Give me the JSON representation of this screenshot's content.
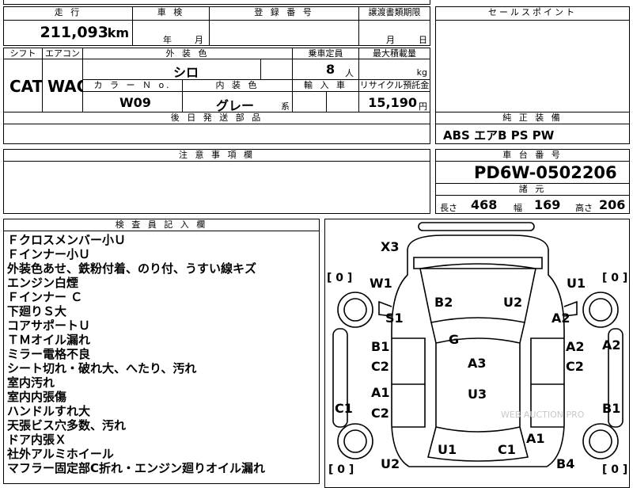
{
  "top_labels": {
    "mileage": "走 行",
    "inspection": "車 検",
    "registration": "登 録 番 号",
    "transfer_deadline": "譲渡書類期限",
    "sales_point": "セールスポイント"
  },
  "values": {
    "mileage": "211,093",
    "mileage_unit": "km",
    "inspection_year": "年",
    "inspection_month": "月",
    "deadline_month": "月",
    "deadline_day": "日"
  },
  "row2": {
    "shift_label": "シフト",
    "aircon_label": "エアコン",
    "exterior_color_label": "外 装 色",
    "capacity_label": "乗車定員",
    "max_load_label": "最大積載量",
    "shift": "CAT",
    "aircon": "WAC",
    "exterior_color": "シロ",
    "capacity": "8",
    "capacity_unit": "人",
    "max_load_unit": "kg",
    "color_no_label": "カ ラ ー Ｎ o.",
    "interior_color_label": "内 装 色",
    "import_label": "輸 入 車",
    "recycle_label": "リサイクル預託金",
    "color_no": "W09",
    "interior_color": "グレー",
    "interior_suffix": "系",
    "recycle_fee": "15,190",
    "recycle_unit": "円"
  },
  "later_parts_label": "後 日 発 送 部 品",
  "standard_equipment_label": "純 正 装 備",
  "standard_equipment": "ABS エアB PS PW",
  "notes_label": "注 意 事 項 欄",
  "chassis_label": "車 台 番 号",
  "chassis_no": "PD6W-0502206",
  "specs_label": "諸 元",
  "specs": {
    "length_label": "長さ",
    "length": "468",
    "width_label": "幅",
    "width": "169",
    "height_label": "高さ",
    "height": "206"
  },
  "inspector_label": "検 査 員 記 入 欄",
  "inspector_notes": [
    "Ｆクロスメンバー小Ｕ",
    "Ｆインナー小Ｕ",
    "外装色あせ、鉄粉付着、のり付、うすい線キズ",
    "エンジン白煙",
    "Ｆインナー Ｃ",
    "下廻りＳ大",
    "コアサポートＵ",
    "ＴＭオイル漏れ",
    "ミラー電格不良",
    "シート切れ・破れ大、へたり、汚れ",
    "室内汚れ",
    "室内内張傷",
    "ハンドルすれ大",
    "天張ビス穴多数、汚れ",
    "ドア内張Ｘ",
    "社外アルミホイール",
    "マフラー固定部C折れ・エンジン廻りオイル漏れ"
  ],
  "diagram": {
    "tire_fl": "[ 0 ]",
    "tire_fr": "[ 0 ]",
    "tire_rl": "[ 0 ]",
    "tire_rr": "[ 0 ]",
    "marks": {
      "x3": "X3",
      "w1": "W1",
      "u1_front": "U1",
      "b2": "B2",
      "u2_hood": "U2",
      "s1": "S1",
      "a2_fender": "A2",
      "b1_door": "B1",
      "g": "G",
      "a2_door": "A2",
      "a2_out": "A2",
      "c2_left1": "C2",
      "a3": "A3",
      "c2_right": "C2",
      "a1_left": "A1",
      "u3": "U3",
      "c1_left": "C1",
      "c2_left2": "C2",
      "b1_right": "B1",
      "u1_rear": "U1",
      "c1_rear": "C1",
      "a1_rear": "A1",
      "u2_rear": "U2",
      "b4": "B4"
    },
    "watermark": "WEB AUCTION PRO"
  }
}
